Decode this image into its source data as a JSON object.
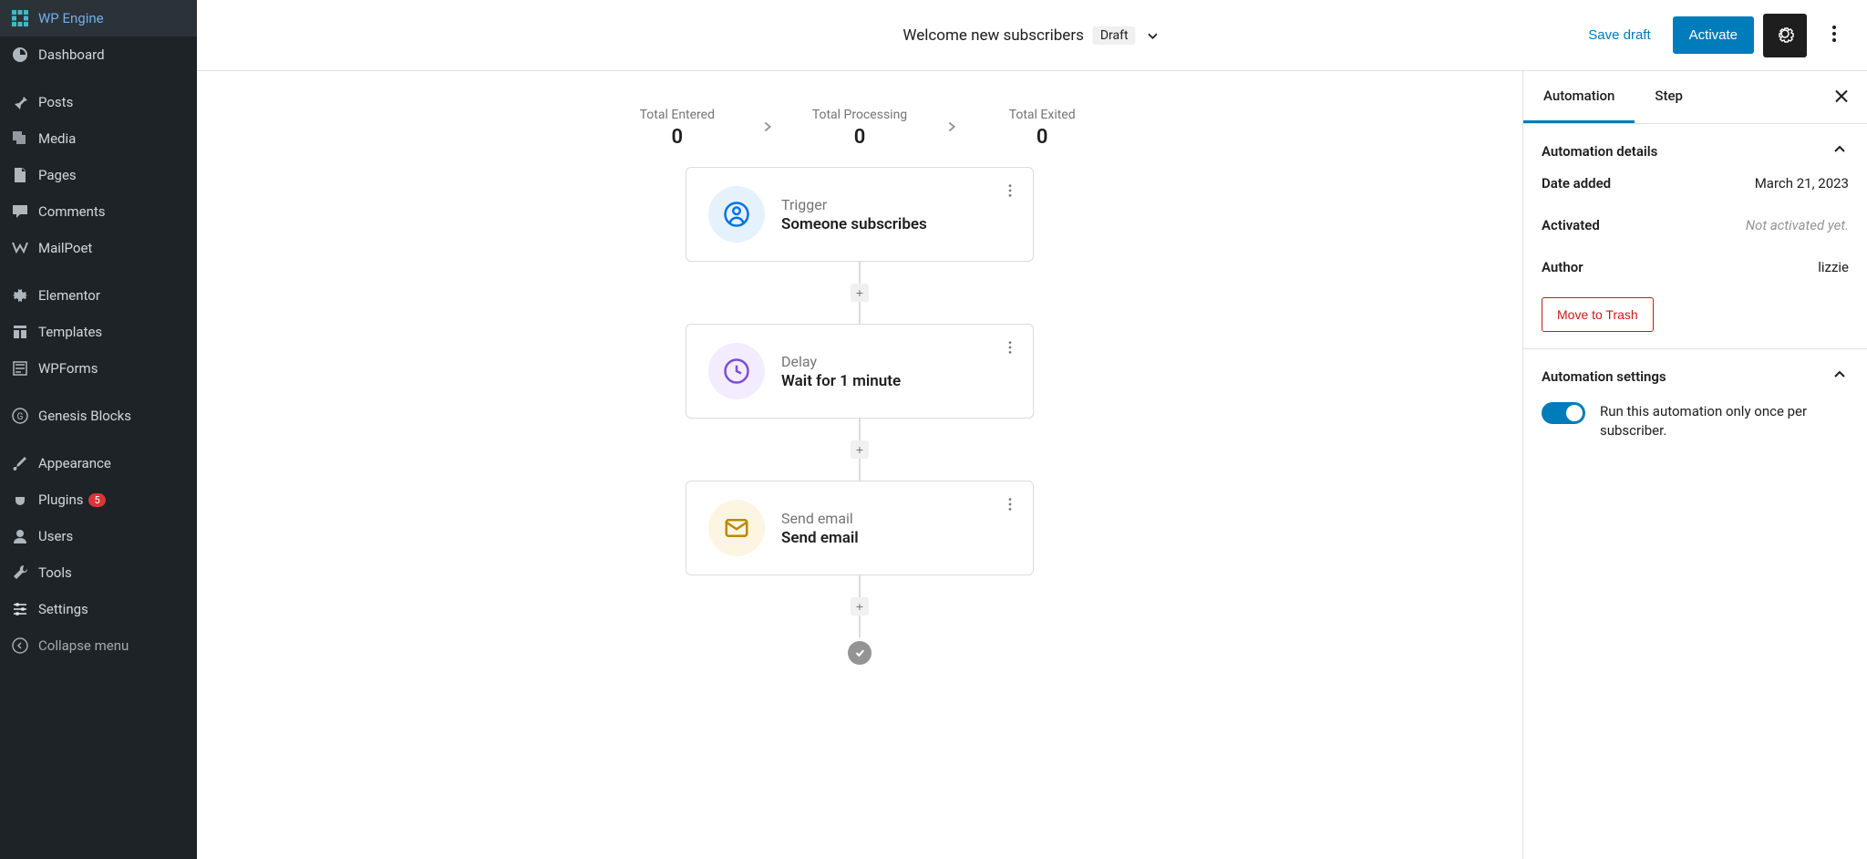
{
  "sidebar": {
    "brand": "WP Engine",
    "items": [
      {
        "label": "Dashboard"
      },
      {
        "label": "Posts"
      },
      {
        "label": "Media"
      },
      {
        "label": "Pages"
      },
      {
        "label": "Comments"
      },
      {
        "label": "MailPoet"
      },
      {
        "label": "Elementor"
      },
      {
        "label": "Templates"
      },
      {
        "label": "WPForms"
      },
      {
        "label": "Genesis Blocks"
      },
      {
        "label": "Appearance"
      },
      {
        "label": "Plugins",
        "badge": "5"
      },
      {
        "label": "Users"
      },
      {
        "label": "Tools"
      },
      {
        "label": "Settings"
      }
    ],
    "collapse": "Collapse menu"
  },
  "header": {
    "title": "Welcome new subscribers",
    "draft_label": "Draft",
    "save_draft": "Save draft",
    "activate": "Activate"
  },
  "stats": {
    "entered_label": "Total Entered",
    "entered_value": "0",
    "processing_label": "Total Processing",
    "processing_value": "0",
    "exited_label": "Total Exited",
    "exited_value": "0"
  },
  "flow": {
    "nodes": [
      {
        "label": "Trigger",
        "title": "Someone subscribes"
      },
      {
        "label": "Delay",
        "title": "Wait for 1 minute"
      },
      {
        "label": "Send email",
        "title": "Send email"
      }
    ]
  },
  "panel": {
    "tabs": {
      "automation": "Automation",
      "step": "Step"
    },
    "details": {
      "title": "Automation details",
      "date_label": "Date added",
      "date_value": "March 21, 2023",
      "activated_label": "Activated",
      "activated_value": "Not activated yet.",
      "author_label": "Author",
      "author_value": "lizzie",
      "trash": "Move to Trash"
    },
    "settings": {
      "title": "Automation settings",
      "toggle_label": "Run this automation only once per subscriber."
    }
  }
}
